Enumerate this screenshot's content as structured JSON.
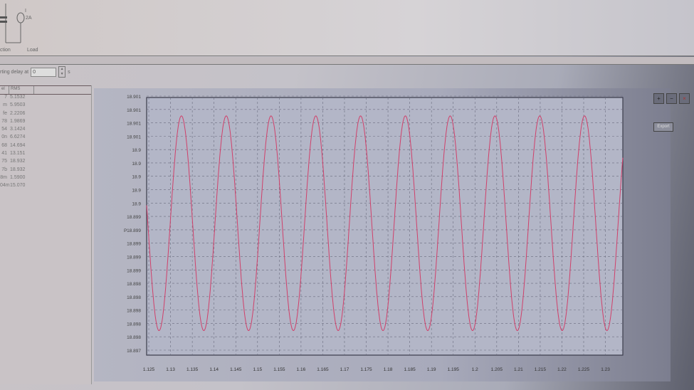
{
  "top_panel": {
    "symbol_label_1": "I",
    "symbol_label_2": "2A",
    "tab_left": "ction",
    "tab_right": "Load"
  },
  "delay": {
    "label": "rting delay at",
    "value": "0",
    "unit": "s"
  },
  "table": {
    "headers": [
      "el",
      "RMS"
    ],
    "rows": [
      [
        "7",
        "5.1532"
      ],
      [
        "m",
        "5.9503"
      ],
      [
        "fe",
        "2.2206"
      ],
      [
        "78",
        "1.9869"
      ],
      [
        "54",
        "3.1424"
      ],
      [
        "0n",
        "6.6274"
      ],
      [
        "68",
        "14.694"
      ],
      [
        "41",
        "13.151"
      ],
      [
        "75",
        "18.932"
      ],
      [
        "7b",
        "18.932"
      ],
      [
        "8m",
        "1.5900"
      ],
      [
        "04m",
        "15.070"
      ]
    ]
  },
  "toolbar": {
    "zoom_in": "zoom-in-icon",
    "zoom_out": "zoom-out-icon",
    "close": "close-icon",
    "button_label": "Export"
  },
  "cursor_marker": "P",
  "chart_data": {
    "type": "line",
    "title": "",
    "xlabel": "",
    "ylabel": "",
    "x_ticks": [
      "1.125",
      "1.13",
      "1.135",
      "1.14",
      "1.145",
      "1.15",
      "1.155",
      "1.16",
      "1.165",
      "1.17",
      "1.175",
      "1.18",
      "1.185",
      "1.19",
      "1.195",
      "1.2",
      "1.205",
      "1.21",
      "1.215",
      "1.22",
      "1.225",
      "1.23"
    ],
    "y_ticks": [
      "18.901",
      "18.901",
      "18.901",
      "18.901",
      "18.9",
      "18.9",
      "18.9",
      "18.9",
      "18.9",
      "18.899",
      "18.899",
      "18.899",
      "18.899",
      "18.899",
      "18.898",
      "18.898",
      "18.898",
      "18.898",
      "18.898",
      "18.897"
    ],
    "xlim": [
      1.1245,
      1.234
    ],
    "ylim": [
      18.8969,
      18.9011
    ],
    "grid": true,
    "series": [
      {
        "name": "signal",
        "color": "#d0406a",
        "form": "sine",
        "offset": 18.89905,
        "amplitude": 0.00175,
        "period": 0.0103,
        "peak_at": 1.1325
      }
    ]
  }
}
